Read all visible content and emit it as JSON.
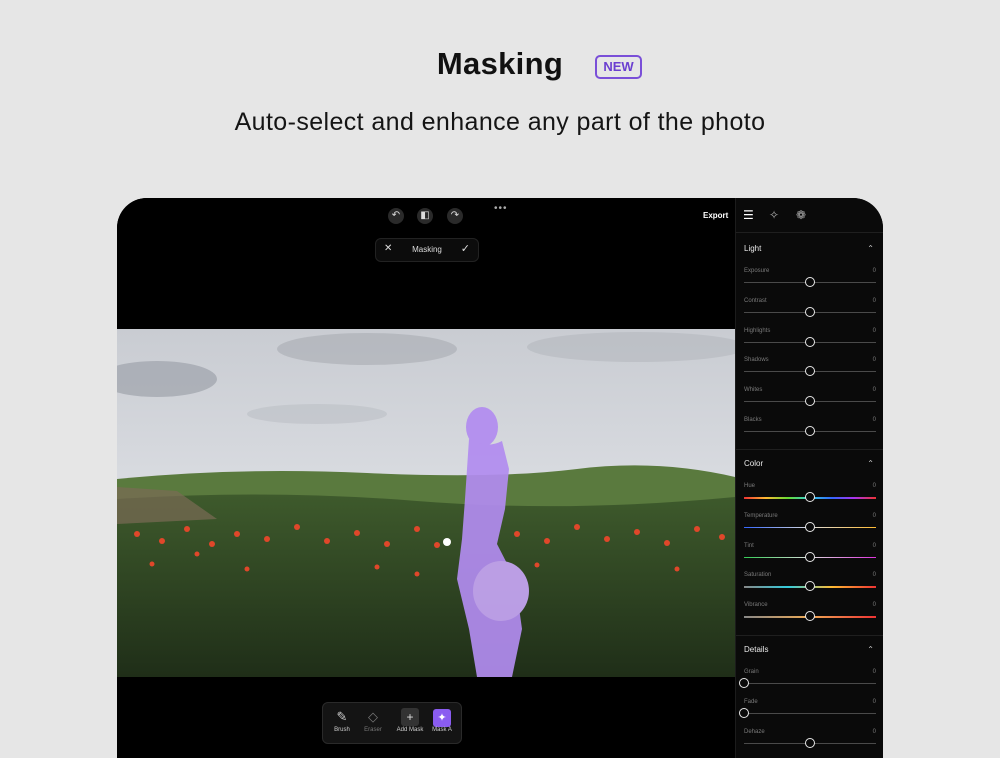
{
  "hero": {
    "title": "Masking",
    "badge": "NEW",
    "subtitle": "Auto-select and enhance any part of the photo"
  },
  "topbar": {
    "undo_icon": "undo-icon",
    "compare_icon": "compare-icon",
    "redo_icon": "redo-icon",
    "more": "•••",
    "export_label": "Export"
  },
  "mode_pill": {
    "close": "✕",
    "label": "Masking",
    "confirm": "✓"
  },
  "panel_tabs": [
    "adjust-icon",
    "effects-icon",
    "mix-icon"
  ],
  "sections": [
    {
      "title": "Light",
      "sliders": [
        {
          "label": "Exposure",
          "value": "0",
          "level": 0.5
        },
        {
          "label": "Contrast",
          "value": "0",
          "level": 0.5
        },
        {
          "label": "Highlights",
          "value": "0",
          "level": 0.5
        },
        {
          "label": "Shadows",
          "value": "0",
          "level": 0.5
        },
        {
          "label": "Whites",
          "value": "0",
          "level": 0.5
        },
        {
          "label": "Blacks",
          "value": "0",
          "level": 0.5
        }
      ]
    },
    {
      "title": "Color",
      "sliders": [
        {
          "label": "Hue",
          "value": "0",
          "level": 0.5
        },
        {
          "label": "Temperature",
          "value": "0",
          "level": 0.5
        },
        {
          "label": "Tint",
          "value": "0",
          "level": 0.5
        },
        {
          "label": "Saturation",
          "value": "0",
          "level": 0.5
        },
        {
          "label": "Vibrance",
          "value": "0",
          "level": 0.5
        }
      ]
    },
    {
      "title": "Details",
      "sliders": [
        {
          "label": "Grain",
          "value": "0",
          "level": 0.0
        },
        {
          "label": "Fade",
          "value": "0",
          "level": 0.0
        },
        {
          "label": "Dehaze",
          "value": "0",
          "level": 0.5
        }
      ]
    }
  ],
  "tools": [
    {
      "label": "Brush",
      "icon": "brush-icon"
    },
    {
      "label": "Eraser",
      "icon": "eraser-icon"
    },
    {
      "label": "Add Mask",
      "icon": "plus-icon"
    },
    {
      "label": "Mask A",
      "icon": "mask-icon"
    }
  ],
  "colors": {
    "accent": "#7a4fd8",
    "mask_overlay": "#b28cf0"
  }
}
